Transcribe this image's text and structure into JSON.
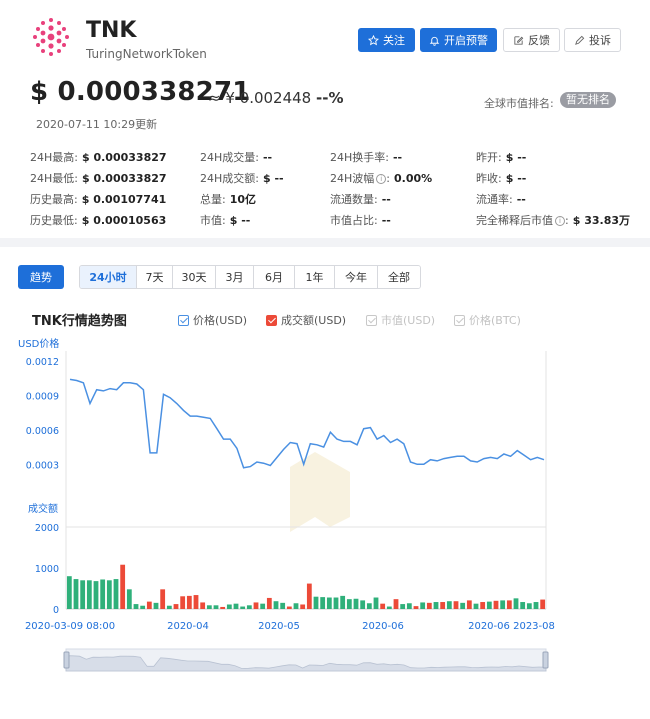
{
  "coin": {
    "symbol": "TNK",
    "full_name": "TuringNetworkToken",
    "price_usd": "$ 0.000338271",
    "price_cny": "≈ ¥ 0.002448",
    "change": "--%",
    "updated": "2020-07-11 10:29更新",
    "rank_label": "全球市值排名:",
    "rank_value": "暂无排名"
  },
  "actions": {
    "follow": "关注",
    "alert": "开启预警",
    "feedback": "反馈",
    "complaint": "投诉"
  },
  "stats": [
    {
      "label": "24H最高:",
      "value": "$ 0.00033827"
    },
    {
      "label": "24H成交量:",
      "value": "--"
    },
    {
      "label": "24H换手率:",
      "value": "--"
    },
    {
      "label": "昨开:",
      "value": "$ --"
    },
    {
      "label": "24H最低:",
      "value": "$ 0.00033827"
    },
    {
      "label": "24H成交额:",
      "value": "$ --"
    },
    {
      "label": "24H波幅",
      "value": "0.00%"
    },
    {
      "label": "昨收:",
      "value": "$ --"
    },
    {
      "label": "历史最高:",
      "value": "$ 0.00107741"
    },
    {
      "label": "总量:",
      "value": "10亿"
    },
    {
      "label": "流通数量:",
      "value": "--"
    },
    {
      "label": "流通率:",
      "value": "--"
    },
    {
      "label": "历史最低:",
      "value": "$ 0.00010563"
    },
    {
      "label": "市值:",
      "value": "$ --"
    },
    {
      "label": "市值占比:",
      "value": "--"
    },
    {
      "label": "完全稀释后市值",
      "value": "$ 33.83万"
    }
  ],
  "controls": {
    "trend_button": "趋势",
    "ranges": [
      "24小时",
      "7天",
      "30天",
      "3月",
      "6月",
      "1年",
      "今年",
      "全部"
    ],
    "active_range": 0
  },
  "colors": {
    "accent": "#1e6fd9",
    "price_line": "#4a90e2",
    "volume_up": "#2fb07a",
    "volume_down": "#ec4a38"
  },
  "chart_data": {
    "type": "line",
    "title": "TNK行情趋势图",
    "legend": [
      {
        "name": "价格(USD)",
        "color": "#4a90e2",
        "active": true
      },
      {
        "name": "成交额(USD)",
        "color": "#ec4a38",
        "active": true
      },
      {
        "name": "市值(USD)",
        "color": "#c8c8c8",
        "active": false
      },
      {
        "name": "价格(BTC)",
        "color": "#c8c8c8",
        "active": false
      }
    ],
    "price_axis": {
      "label": "USD价格",
      "ticks": [
        "0.0012",
        "0.0009",
        "0.0006",
        "0.0003"
      ],
      "ylim": [
        0.00012,
        0.0012
      ]
    },
    "volume_axis": {
      "label": "成交额",
      "ticks": [
        "2000",
        "1000",
        "0"
      ],
      "ylim": [
        0,
        2000
      ]
    },
    "x_tick_labels": [
      "2020-03-09 08:00",
      "2020-04",
      "2020-05",
      "2020-06",
      "2020-06",
      "2023-08"
    ],
    "price_series": {
      "name": "价格(USD)",
      "values": [
        0.00104,
        0.00103,
        0.00101,
        0.00083,
        0.00095,
        0.00094,
        0.00096,
        0.00095,
        0.00101,
        0.00101,
        0.001,
        0.00095,
        0.0004,
        0.0004,
        0.00091,
        0.00088,
        0.00083,
        0.00077,
        0.00072,
        0.00072,
        0.00071,
        0.0007,
        0.00061,
        0.00052,
        0.00052,
        0.00044,
        0.00027,
        0.00028,
        0.00032,
        0.00031,
        0.00029,
        0.00036,
        0.00043,
        0.00049,
        0.00048,
        0.0003,
        0.00048,
        0.00047,
        0.00045,
        0.00058,
        0.00052,
        0.0005,
        0.0005,
        0.00047,
        0.00061,
        0.00062,
        0.00052,
        0.00055,
        0.00049,
        0.00052,
        0.00048,
        0.00032,
        0.0003,
        0.0003,
        0.00034,
        0.00033,
        0.00035,
        0.00036,
        0.00037,
        0.00037,
        0.00033,
        0.00032,
        0.00035,
        0.00036,
        0.00035,
        0.00039,
        0.00037,
        0.00042,
        0.00038,
        0.00034,
        0.00036,
        0.00034
      ]
    },
    "volume_series": {
      "name": "成交额(USD)",
      "values": [
        800,
        730,
        700,
        700,
        680,
        720,
        700,
        730,
        1080,
        480,
        120,
        80,
        180,
        150,
        480,
        80,
        120,
        310,
        320,
        340,
        160,
        90,
        90,
        50,
        110,
        130,
        60,
        90,
        160,
        130,
        270,
        190,
        150,
        60,
        140,
        110,
        620,
        300,
        290,
        280,
        280,
        320,
        240,
        250,
        210,
        140,
        280,
        130,
        60,
        240,
        120,
        140,
        70,
        160,
        150,
        170,
        170,
        190,
        190,
        150,
        210,
        130,
        170,
        180,
        200,
        210,
        210,
        260,
        170,
        140,
        170,
        230
      ],
      "directions": [
        "up",
        "up",
        "up",
        "up",
        "up",
        "up",
        "up",
        "up",
        "down",
        "up",
        "up",
        "up",
        "down",
        "up",
        "down",
        "up",
        "down",
        "down",
        "down",
        "down",
        "down",
        "up",
        "up",
        "down",
        "up",
        "up",
        "up",
        "up",
        "down",
        "up",
        "down",
        "up",
        "up",
        "down",
        "up",
        "down",
        "down",
        "up",
        "up",
        "up",
        "up",
        "up",
        "up",
        "up",
        "up",
        "up",
        "up",
        "down",
        "up",
        "down",
        "up",
        "up",
        "down",
        "up",
        "down",
        "up",
        "down",
        "up",
        "down",
        "up",
        "down",
        "up",
        "down",
        "up",
        "down",
        "up",
        "down",
        "up",
        "up",
        "up",
        "up",
        "down"
      ]
    }
  }
}
